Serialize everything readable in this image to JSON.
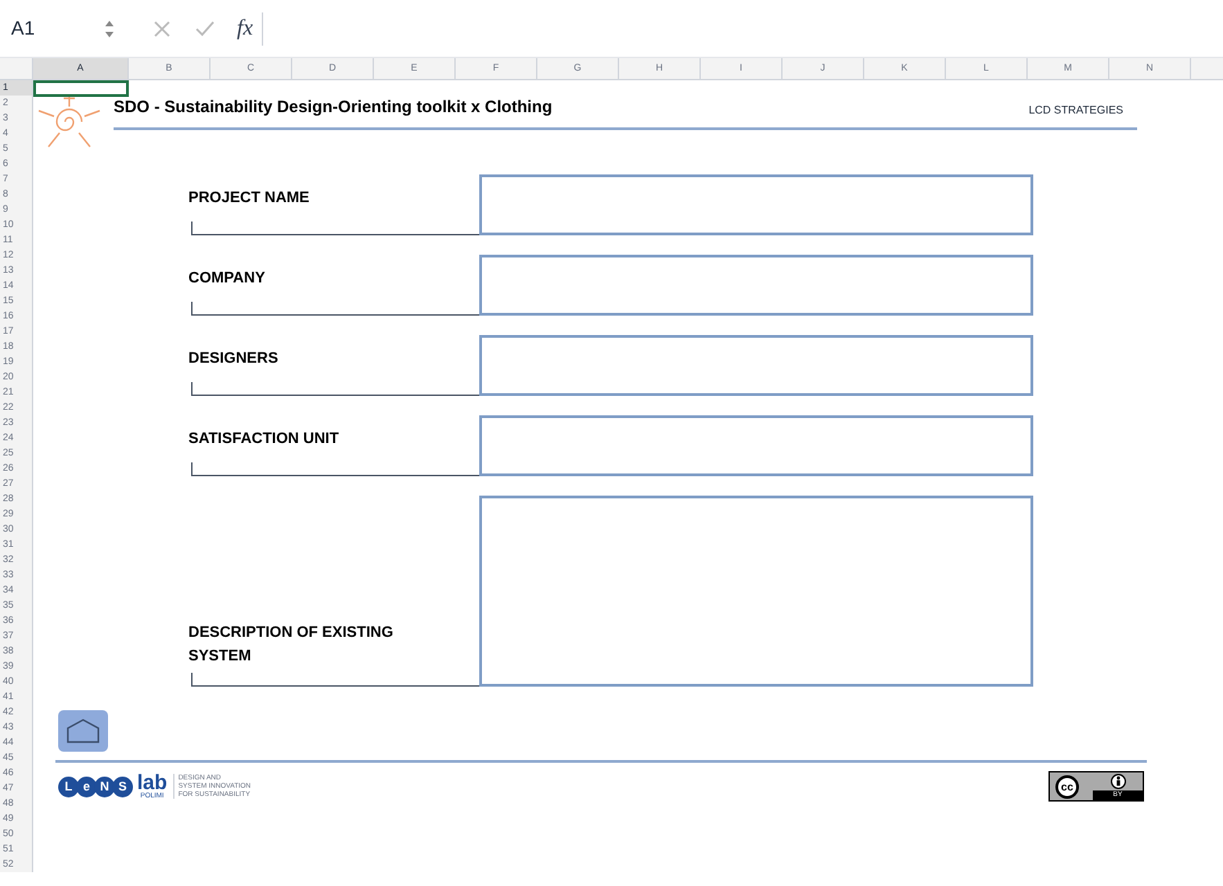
{
  "formula_bar": {
    "cell_ref": "A1",
    "fx": "fx"
  },
  "columns": [
    {
      "label": "A",
      "selected": true
    },
    {
      "label": "B",
      "selected": false
    },
    {
      "label": "C",
      "selected": false
    },
    {
      "label": "D",
      "selected": false
    },
    {
      "label": "E",
      "selected": false
    },
    {
      "label": "F",
      "selected": false
    },
    {
      "label": "G",
      "selected": false
    },
    {
      "label": "H",
      "selected": false
    },
    {
      "label": "I",
      "selected": false
    },
    {
      "label": "J",
      "selected": false
    },
    {
      "label": "K",
      "selected": false
    },
    {
      "label": "L",
      "selected": false
    },
    {
      "label": "M",
      "selected": false
    },
    {
      "label": "N",
      "selected": false
    }
  ],
  "rows": [
    {
      "label": "1",
      "selected": true
    },
    {
      "label": "2",
      "selected": false
    },
    {
      "label": "3",
      "selected": false
    },
    {
      "label": "4",
      "selected": false
    },
    {
      "label": "5",
      "selected": false
    },
    {
      "label": "6",
      "selected": false
    },
    {
      "label": "7",
      "selected": false
    },
    {
      "label": "8",
      "selected": false
    },
    {
      "label": "9",
      "selected": false
    },
    {
      "label": "10",
      "selected": false
    },
    {
      "label": "11",
      "selected": false
    },
    {
      "label": "12",
      "selected": false
    },
    {
      "label": "13",
      "selected": false
    },
    {
      "label": "14",
      "selected": false
    },
    {
      "label": "15",
      "selected": false
    },
    {
      "label": "16",
      "selected": false
    },
    {
      "label": "17",
      "selected": false
    },
    {
      "label": "18",
      "selected": false
    },
    {
      "label": "19",
      "selected": false
    },
    {
      "label": "20",
      "selected": false
    },
    {
      "label": "21",
      "selected": false
    },
    {
      "label": "22",
      "selected": false
    },
    {
      "label": "23",
      "selected": false
    },
    {
      "label": "24",
      "selected": false
    },
    {
      "label": "25",
      "selected": false
    },
    {
      "label": "26",
      "selected": false
    },
    {
      "label": "27",
      "selected": false
    },
    {
      "label": "28",
      "selected": false
    },
    {
      "label": "29",
      "selected": false
    },
    {
      "label": "30",
      "selected": false
    },
    {
      "label": "31",
      "selected": false
    },
    {
      "label": "32",
      "selected": false
    },
    {
      "label": "33",
      "selected": false
    },
    {
      "label": "34",
      "selected": false
    },
    {
      "label": "35",
      "selected": false
    },
    {
      "label": "36",
      "selected": false
    },
    {
      "label": "37",
      "selected": false
    },
    {
      "label": "38",
      "selected": false
    },
    {
      "label": "39",
      "selected": false
    },
    {
      "label": "40",
      "selected": false
    },
    {
      "label": "41",
      "selected": false
    },
    {
      "label": "42",
      "selected": false
    },
    {
      "label": "43",
      "selected": false
    },
    {
      "label": "44",
      "selected": false
    },
    {
      "label": "45",
      "selected": false
    },
    {
      "label": "46",
      "selected": false
    },
    {
      "label": "47",
      "selected": false
    },
    {
      "label": "48",
      "selected": false
    },
    {
      "label": "49",
      "selected": false
    },
    {
      "label": "50",
      "selected": false
    },
    {
      "label": "51",
      "selected": false
    },
    {
      "label": "52",
      "selected": false
    }
  ],
  "sheet": {
    "title": "SDO - Sustainability Design-Orienting toolkit x Clothing",
    "section": "LCD STRATEGIES",
    "fields": [
      {
        "label": "PROJECT NAME",
        "kind": "single"
      },
      {
        "label": "COMPANY",
        "kind": "single"
      },
      {
        "label": "DESIGNERS",
        "kind": "single"
      },
      {
        "label": "SATISFACTION UNIT",
        "kind": "single"
      },
      {
        "label": "DESCRIPTION OF EXISTING SYSTEM",
        "kind": "multi"
      }
    ],
    "footer": {
      "logo_letters": [
        "L",
        "e",
        "N",
        "S"
      ],
      "logo_lab": "lab",
      "logo_sub": "POLIMI",
      "tagline": [
        "DESIGN AND",
        "SYSTEM INNOVATION",
        "FOR SUSTAINABILITY"
      ],
      "license_cc": "cc",
      "license_by": "BY"
    }
  }
}
